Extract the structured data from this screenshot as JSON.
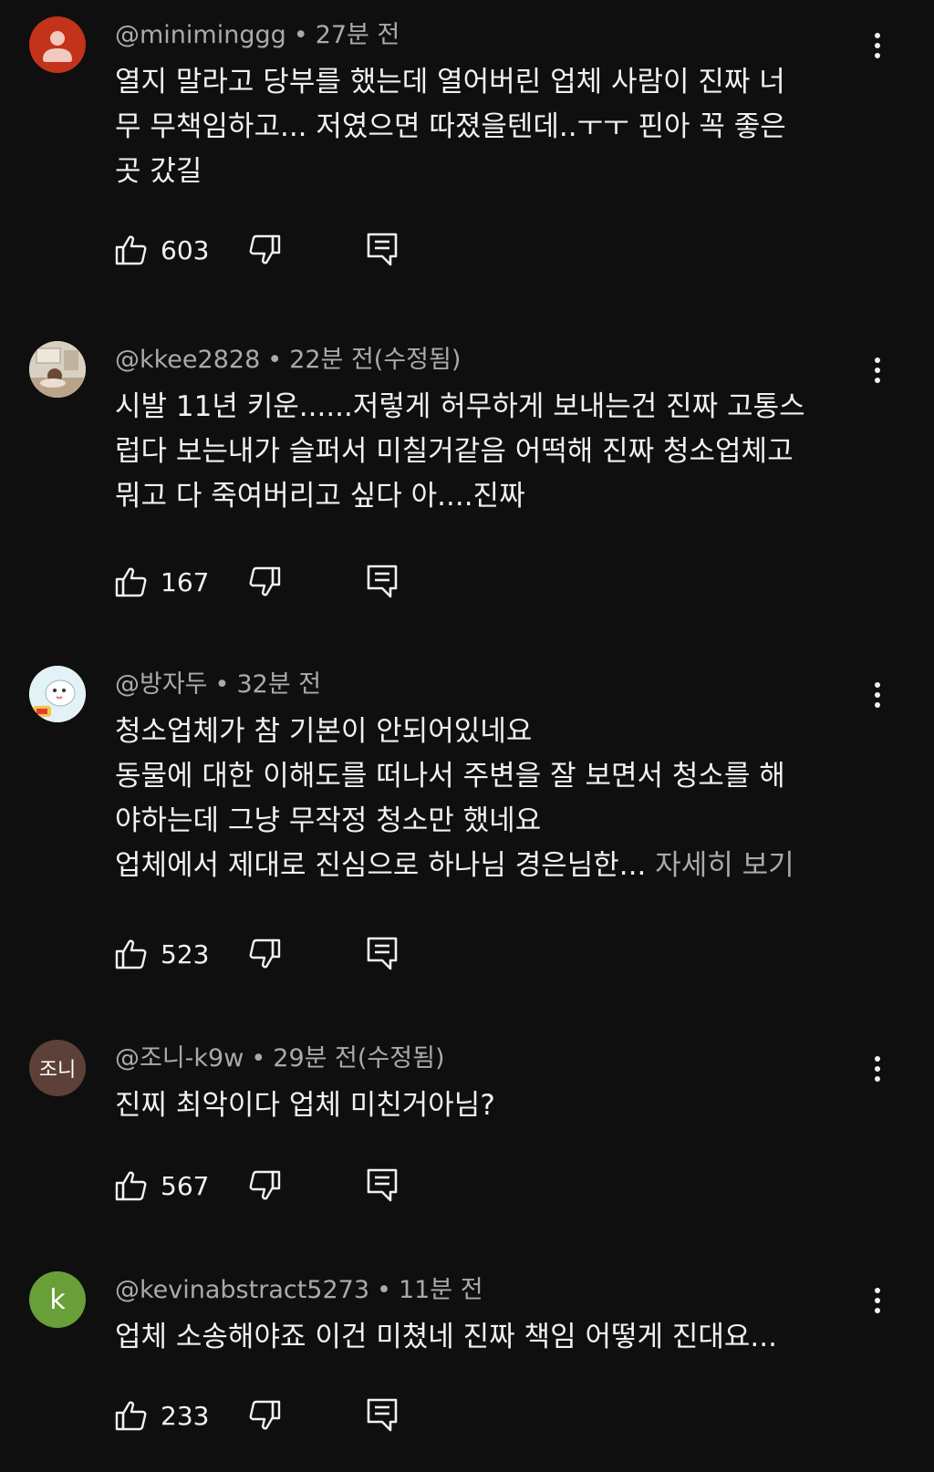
{
  "comments": [
    {
      "avatar_type": "default-user",
      "avatar_color": "#c2331a",
      "author": "@miniminggg",
      "separator": "•",
      "time": "27분 전",
      "lines": [
        "열지 말라고 당부를 했는데 열어버린 업체 사람이 진짜 너",
        "무 무책임하고... 저였으면 따졌을텐데..ㅜㅜ 핀아 꼭 좋은",
        "곳 갔길"
      ],
      "likes": "603"
    },
    {
      "avatar_type": "photo-room",
      "avatar_color": "#d8d0c2",
      "author": "@kkee2828",
      "separator": "•",
      "time": "22분 전(수정됨)",
      "lines": [
        "시발 11년 키운......저렇게 허무하게 보내는건 진짜 고통스",
        "럽다 보는내가 슬퍼서 미칠거같음 어떡해 진짜 청소업체고",
        "뭐고 다 죽여버리고 싶다 아....진짜"
      ],
      "likes": "167"
    },
    {
      "avatar_type": "illustration-bird",
      "avatar_color": "#cfe7ef",
      "author": "@방자두",
      "separator": "•",
      "time": "32분 전",
      "lines": [
        "청소업체가 참 기본이 안되어있네요",
        "동물에 대한 이해도를 떠나서 주변을 잘 보면서 청소를 해",
        "야하는데 그냥 무작정 청소만 했네요",
        "업체에서 제대로 진심으로 하나님 경은님한..."
      ],
      "more_label": "자세히 보기",
      "likes": "523"
    },
    {
      "avatar_type": "text",
      "avatar_color": "#5d4037",
      "avatar_text": "조니",
      "author": "@조니-k9w",
      "separator": "•",
      "time": "29분 전(수정됨)",
      "lines": [
        "진찌 최악이다 업체 미친거아님?"
      ],
      "likes": "567"
    },
    {
      "avatar_type": "letter",
      "avatar_color": "#689f38",
      "avatar_text": "k",
      "author": "@kevinabstract5273",
      "separator": "•",
      "time": "11분 전",
      "lines": [
        "업체 소송해야죠 이건 미쳤네 진짜 책임 어떻게 진대요..."
      ],
      "likes": "233"
    }
  ]
}
